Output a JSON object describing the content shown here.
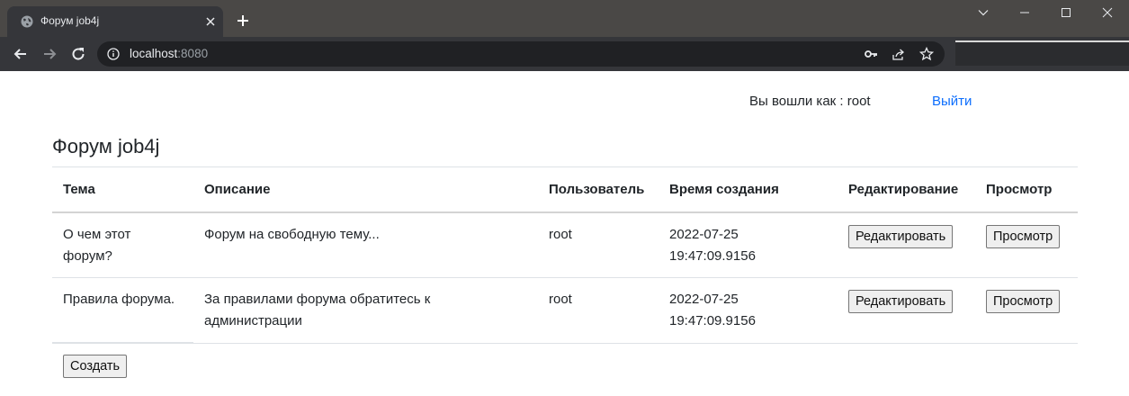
{
  "browser": {
    "tab_title": "Форум job4j",
    "url_host": "localhost",
    "url_port": ":8080"
  },
  "userbar": {
    "logged_in_text": "Вы вошли как : root",
    "logout_label": "Выйти"
  },
  "page": {
    "title": "Форум job4j"
  },
  "table": {
    "headers": [
      "Тема",
      "Описание",
      "Пользователь",
      "Время создания",
      "Редактирование",
      "Просмотр"
    ],
    "rows": [
      {
        "topic": "О чем этот форум?",
        "description": "Форум на свободную тему...",
        "user": "root",
        "created": "2022-07-25 19:47:09.9156",
        "edit_label": "Редактировать",
        "view_label": "Просмотр"
      },
      {
        "topic": "Правила форума.",
        "description": "За правилами форума обратитесь к администрации",
        "user": "root",
        "created": "2022-07-25 19:47:09.9156",
        "edit_label": "Редактировать",
        "view_label": "Просмотр"
      }
    ]
  },
  "actions": {
    "create_label": "Создать"
  },
  "icons": {
    "favicon": "globe-icon",
    "back": "arrow-left-icon",
    "forward": "arrow-right-icon",
    "reload": "reload-icon",
    "site_info": "info-icon",
    "password": "key-icon",
    "share": "share-icon",
    "bookmark": "star-icon"
  },
  "colors": {
    "link": "#0d6efd",
    "chrome_dark": "#35363a",
    "titlebar": "#4a4846"
  }
}
